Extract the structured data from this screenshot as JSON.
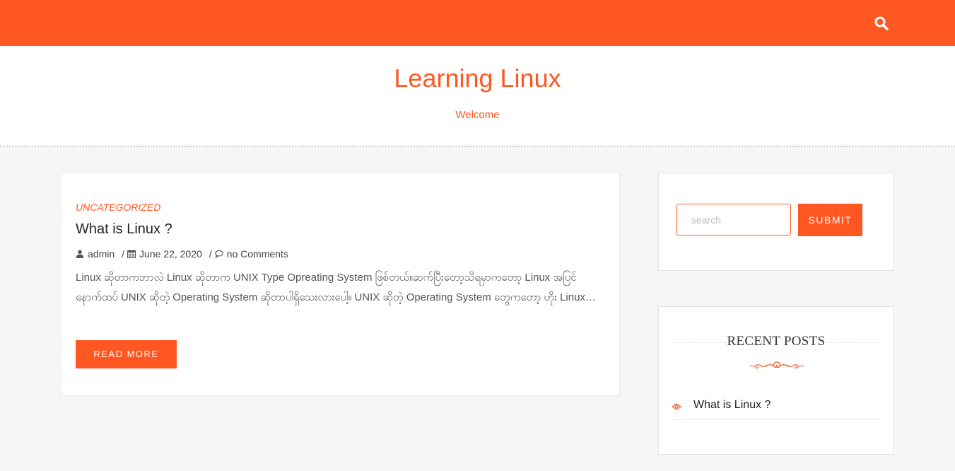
{
  "site": {
    "title": "Learning Linux",
    "tagline": "Welcome",
    "accent_color": "#ff5722"
  },
  "topbar": {
    "search_icon": "search-icon"
  },
  "post": {
    "category": "UNCATEGORIZED",
    "title": "What is Linux ?",
    "author": "admin",
    "date": "June 22, 2020",
    "comments": "no Comments",
    "meta_icons": [
      "user-icon",
      "calendar-icon",
      "comment-icon"
    ],
    "excerpt": "Linux ဆိုတာကဘာလဲ Linux ဆိုတာက UNIX Type Opreating System ဖြစ်တယ်။ဆက်ပြီးတော့သိရမှာကတော့ Linux အပြင်နောက်ထပ် UNIX ဆိုတဲ့ Operating System ဆိုတာပါရှိသေးလားပေါ့။ UNIX ဆိုတဲ့ Operating System တွေကတော့ ဟိုး Linux…",
    "read_more": "READ MORE"
  },
  "sidebar": {
    "search": {
      "placeholder": "search",
      "submit_label": "SUBMIT"
    },
    "recent_posts": {
      "title": "RECENT POSTS",
      "items": [
        {
          "label": "What is Linux ?",
          "icon": "eye-icon"
        }
      ]
    }
  }
}
